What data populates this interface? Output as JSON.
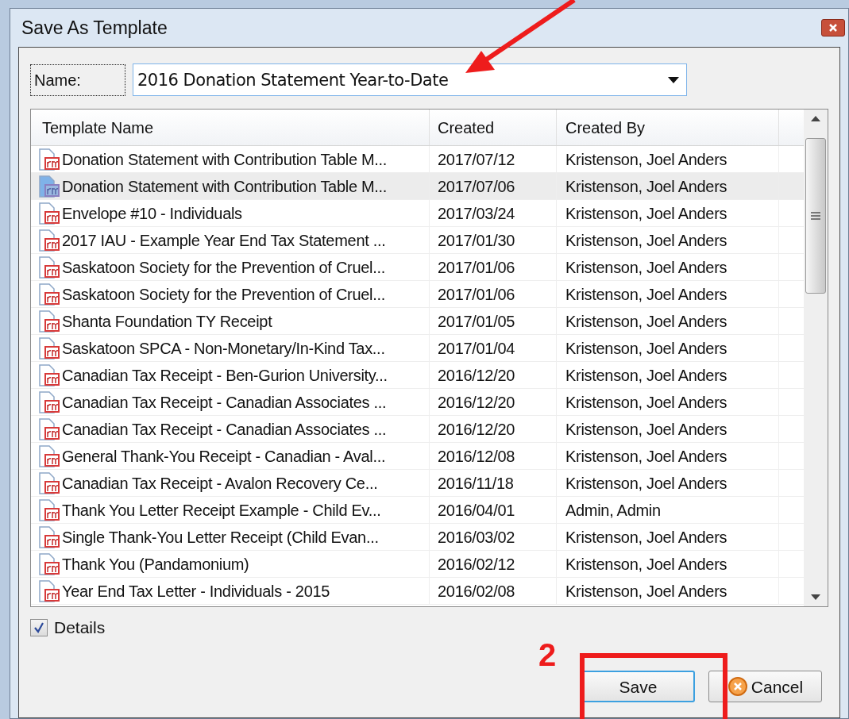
{
  "window": {
    "title": "Save As Template"
  },
  "name_field": {
    "label": "Name:",
    "value": "2016 Donation Statement Year-to-Date"
  },
  "table": {
    "columns": [
      "Template Name",
      "Created",
      "Created By"
    ],
    "rows": [
      {
        "name": "Donation Statement with Contribution Table M...",
        "created": "2017/07/12",
        "created_by": "Kristenson, Joel Anders",
        "selected": false
      },
      {
        "name": "Donation Statement with Contribution Table M...",
        "created": "2017/07/06",
        "created_by": "Kristenson, Joel Anders",
        "selected": true
      },
      {
        "name": "Envelope #10 - Individuals",
        "created": "2017/03/24",
        "created_by": "Kristenson, Joel Anders",
        "selected": false
      },
      {
        "name": "2017 IAU - Example Year End Tax Statement ...",
        "created": "2017/01/30",
        "created_by": "Kristenson, Joel Anders",
        "selected": false
      },
      {
        "name": "Saskatoon Society for the Prevention of Cruel...",
        "created": "2017/01/06",
        "created_by": "Kristenson, Joel Anders",
        "selected": false
      },
      {
        "name": "Saskatoon Society for the Prevention of Cruel...",
        "created": "2017/01/06",
        "created_by": "Kristenson, Joel Anders",
        "selected": false
      },
      {
        "name": "Shanta Foundation TY Receipt",
        "created": "2017/01/05",
        "created_by": "Kristenson, Joel Anders",
        "selected": false
      },
      {
        "name": "Saskatoon SPCA - Non-Monetary/In-Kind Tax...",
        "created": "2017/01/04",
        "created_by": "Kristenson, Joel Anders",
        "selected": false
      },
      {
        "name": "Canadian Tax Receipt - Ben-Gurion University...",
        "created": "2016/12/20",
        "created_by": "Kristenson, Joel Anders",
        "selected": false
      },
      {
        "name": "Canadian Tax Receipt - Canadian Associates ...",
        "created": "2016/12/20",
        "created_by": "Kristenson, Joel Anders",
        "selected": false
      },
      {
        "name": "Canadian Tax Receipt - Canadian Associates ...",
        "created": "2016/12/20",
        "created_by": "Kristenson, Joel Anders",
        "selected": false
      },
      {
        "name": "General Thank-You Receipt - Canadian - Aval...",
        "created": "2016/12/08",
        "created_by": "Kristenson, Joel Anders",
        "selected": false
      },
      {
        "name": "Canadian Tax Receipt - Avalon Recovery Ce...",
        "created": "2016/11/18",
        "created_by": "Kristenson, Joel Anders",
        "selected": false
      },
      {
        "name": "Thank You Letter Receipt Example - Child Ev...",
        "created": "2016/04/01",
        "created_by": "Admin, Admin",
        "selected": false
      },
      {
        "name": "Single Thank-You Letter Receipt (Child Evan...",
        "created": "2016/03/02",
        "created_by": "Kristenson, Joel Anders",
        "selected": false
      },
      {
        "name": "Thank You (Pandamonium)",
        "created": "2016/02/12",
        "created_by": "Kristenson, Joel Anders",
        "selected": false
      },
      {
        "name": "Year End Tax Letter - Individuals - 2015",
        "created": "2016/02/08",
        "created_by": "Kristenson, Joel Anders",
        "selected": false
      }
    ]
  },
  "details": {
    "label": "Details",
    "checked": true
  },
  "annotation": {
    "step": "2"
  },
  "buttons": [
    {
      "kind": "save",
      "label": "Save"
    },
    {
      "kind": "cancel",
      "label": "Cancel"
    }
  ]
}
